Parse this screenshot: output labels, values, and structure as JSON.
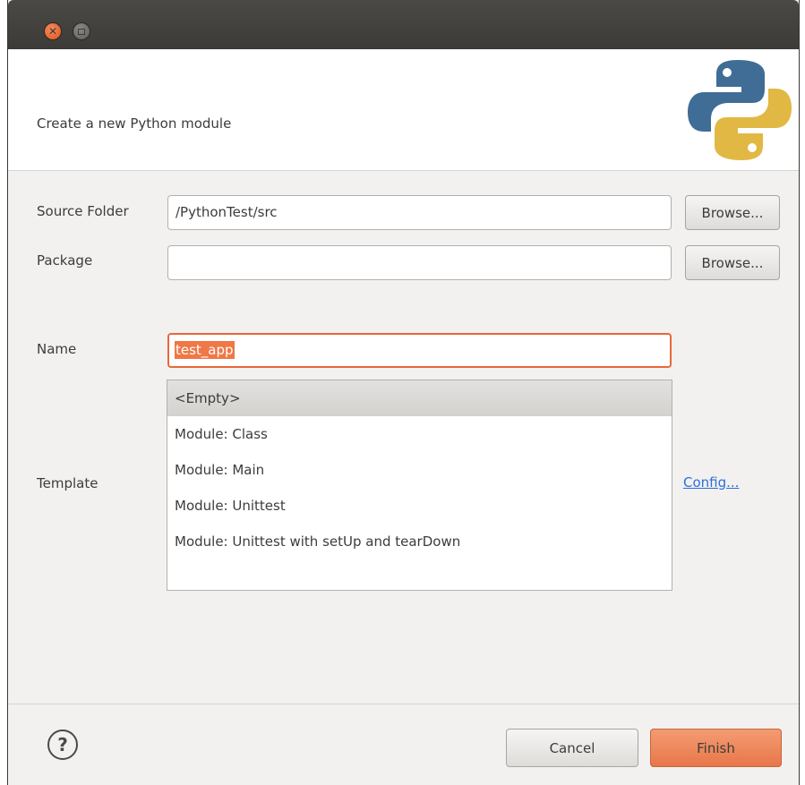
{
  "header": {
    "title": "Create a new Python module"
  },
  "form": {
    "source_folder": {
      "label": "Source Folder",
      "value": "/PythonTest/src",
      "browse_label": "Browse..."
    },
    "package": {
      "label": "Package",
      "value": "",
      "browse_label": "Browse..."
    },
    "name": {
      "label": "Name",
      "value": "test_app"
    },
    "template": {
      "label": "Template",
      "items": [
        "<Empty>",
        "Module: Class",
        "Module: Main",
        "Module: Unittest",
        "Module: Unittest with setUp and tearDown"
      ],
      "selected_index": 0,
      "config_link": "Config..."
    }
  },
  "footer": {
    "help_glyph": "?",
    "cancel_label": "Cancel",
    "finish_label": "Finish"
  },
  "colors": {
    "accent": "#e9673a",
    "finish_button": "#f08a5d",
    "link": "#2c6fd8",
    "titlebar": "#3c3b37"
  },
  "icons": {
    "close": "close-icon",
    "maximize": "maximize-icon",
    "logo": "python-logo-icon",
    "help": "help-icon"
  }
}
